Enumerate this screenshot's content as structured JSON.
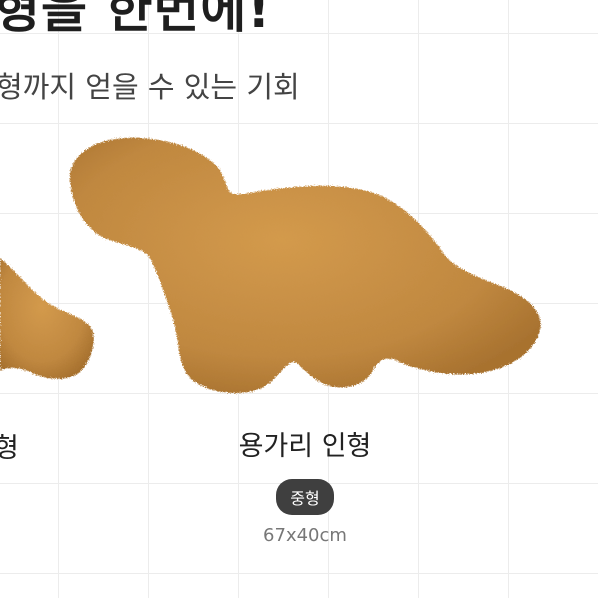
{
  "header": {
    "headline": "형을 한번에!",
    "subline": "형까지 얻을 수 있는 기회"
  },
  "cards": {
    "left": {
      "name": "형"
    },
    "center": {
      "name": "용가리 인형",
      "size_badge": "중형",
      "dimensions": "67x40cm"
    }
  },
  "colors": {
    "background": "#ffffff",
    "grid": "#ececec",
    "plush": "#c18a3f",
    "badge": "#3f3f3f"
  },
  "icons": {
    "left_image": "nugget-plush-partial",
    "center_image": "dinosaur-nugget-plush"
  }
}
